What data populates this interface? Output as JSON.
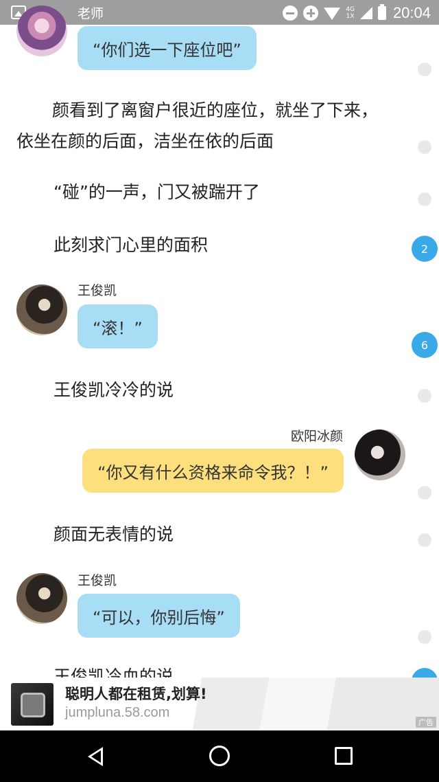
{
  "status_bar": {
    "time": "20:04",
    "network": "4G",
    "network_sub": "1X"
  },
  "messages": [
    {
      "type": "chat",
      "speaker": "老师",
      "text": "“你们选一下座位吧”"
    },
    {
      "type": "narration",
      "text": "颜看到了离窗户很近的座位，就坐了下来，",
      "text2": "依坐在颜的后面，洁坐在依的后面"
    },
    {
      "type": "narration",
      "text": "“碰”的一声，门又被踹开了"
    },
    {
      "type": "narration",
      "text": "此刻求门心里的面积",
      "badge": "2"
    },
    {
      "type": "chat",
      "speaker": "王俊凯",
      "text": "“滚！”",
      "badge": "6"
    },
    {
      "type": "narration",
      "text": "王俊凯冷冷的说"
    },
    {
      "type": "chat",
      "speaker": "欧阳冰颜",
      "text": "“你又有什么资格来命令我？！”"
    },
    {
      "type": "narration",
      "text": "颜面无表情的说"
    },
    {
      "type": "chat",
      "speaker": "王俊凯",
      "text": "“可以，你别后悔”"
    },
    {
      "type": "narration",
      "text": "王俊凯冷血的说"
    }
  ],
  "ad": {
    "title": "聪明人都在租赁,划算!",
    "url": "jumpluna.58.com",
    "tag": "广告"
  }
}
